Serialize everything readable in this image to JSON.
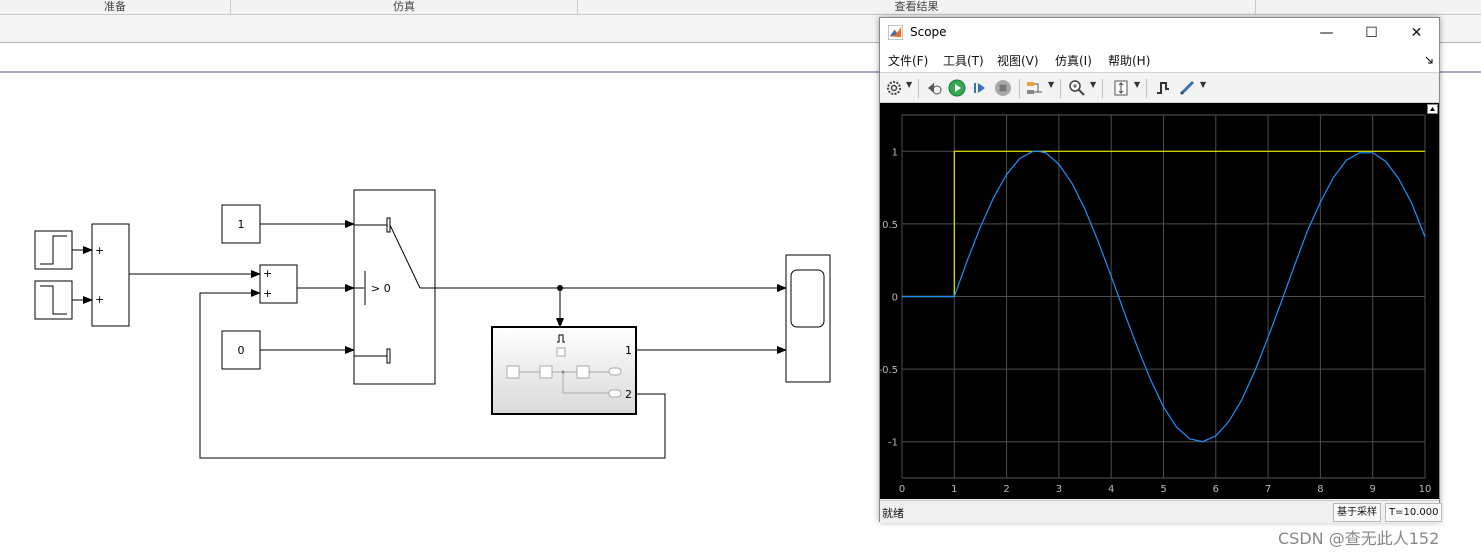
{
  "ribbon": {
    "tabs": [
      {
        "label": "准备"
      },
      {
        "label": "仿真"
      },
      {
        "label": "查看结果"
      }
    ]
  },
  "model": {
    "constant1_value": "1",
    "constant0_value": "0",
    "sum1_signs": [
      "+",
      "+"
    ],
    "sum2_signs": [
      "+",
      "+"
    ],
    "switch_criteria": "> 0",
    "subsystem_ports": [
      "1",
      "2"
    ]
  },
  "scope": {
    "title": "Scope",
    "menu": [
      "文件(F)",
      "工具(T)",
      "视图(V)",
      "仿真(I)",
      "帮助(H)"
    ],
    "window_controls": {
      "minimize": "—",
      "maximize": "☐",
      "close": "✕"
    },
    "status": {
      "left": "就绪",
      "sample_mode": "基于采样",
      "time": "T=10.000"
    },
    "colors": {
      "series_step": "#e6e600",
      "series_sine": "#1e90ff",
      "grid": "#4d4d4d",
      "axes_text": "#b8b8b8"
    }
  },
  "chart_data": {
    "type": "line",
    "xlim": [
      0,
      10
    ],
    "ylim": [
      -1.25,
      1.25
    ],
    "x_ticks": [
      "0",
      "1",
      "2",
      "3",
      "4",
      "5",
      "6",
      "7",
      "8",
      "9",
      "10"
    ],
    "y_ticks": [
      "1",
      "0.5",
      "0",
      "-0.5",
      "-1"
    ],
    "grid": true,
    "series": [
      {
        "color": "#e6e600",
        "x": [
          0,
          1,
          1,
          10
        ],
        "y": [
          0,
          0,
          1,
          1
        ]
      },
      {
        "color": "#1e90ff",
        "x": [
          0,
          1,
          1.25,
          1.5,
          1.75,
          2.0,
          2.25,
          2.5,
          2.6,
          2.75,
          3.0,
          3.25,
          3.5,
          3.75,
          4.0,
          4.25,
          4.5,
          4.75,
          5.0,
          5.25,
          5.5,
          5.75,
          6.0,
          6.25,
          6.5,
          6.75,
          7.0,
          7.25,
          7.5,
          7.75,
          8.0,
          8.25,
          8.5,
          8.75,
          9.0,
          9.25,
          9.5,
          9.75,
          10
        ],
        "y": [
          0,
          0,
          0.25,
          0.48,
          0.68,
          0.84,
          0.95,
          1.0,
          1.0,
          0.99,
          0.91,
          0.78,
          0.6,
          0.38,
          0.14,
          -0.11,
          -0.35,
          -0.57,
          -0.76,
          -0.9,
          -0.98,
          -1.0,
          -0.96,
          -0.86,
          -0.71,
          -0.51,
          -0.28,
          -0.04,
          0.21,
          0.45,
          0.65,
          0.82,
          0.94,
          0.99,
          0.99,
          0.93,
          0.81,
          0.64,
          0.41
        ]
      }
    ]
  }
}
